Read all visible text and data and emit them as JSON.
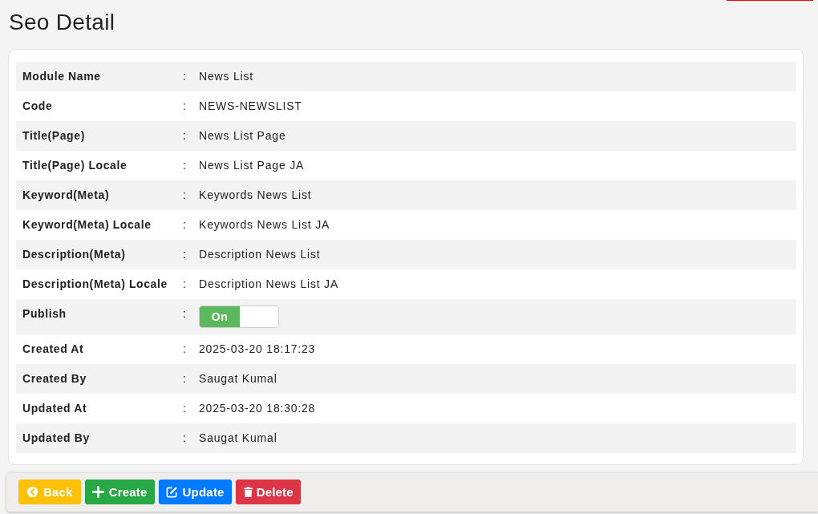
{
  "page": {
    "title": "Seo Detail"
  },
  "details": [
    {
      "kind": "text",
      "label": "Module Name",
      "separator": ":",
      "value": "News List"
    },
    {
      "kind": "text",
      "label": "Code",
      "separator": ":",
      "value": "NEWS-NEWSLIST"
    },
    {
      "kind": "text",
      "label": "Title(Page)",
      "separator": ":",
      "value": "News List Page"
    },
    {
      "kind": "text",
      "label": "Title(Page) Locale",
      "separator": ":",
      "value": "News List Page JA"
    },
    {
      "kind": "text",
      "label": "Keyword(Meta)",
      "separator": ":",
      "value": "Keywords News List"
    },
    {
      "kind": "text",
      "label": "Keyword(Meta) Locale",
      "separator": ":",
      "value": "Keywords News List JA"
    },
    {
      "kind": "text",
      "label": "Description(Meta)",
      "separator": ":",
      "value": "Description News List"
    },
    {
      "kind": "text",
      "label": "Description(Meta) Locale",
      "separator": ":",
      "value": "Description News List JA"
    },
    {
      "kind": "toggle",
      "label": "Publish",
      "separator": ":",
      "toggle": {
        "on": true,
        "text": "On"
      }
    },
    {
      "kind": "text",
      "label": "Created At",
      "separator": ":",
      "value": "2025-03-20 18:17:23"
    },
    {
      "kind": "text",
      "label": "Created By",
      "separator": ":",
      "value": "Saugat Kumal"
    },
    {
      "kind": "text",
      "label": "Updated At",
      "separator": ":",
      "value": "2025-03-20 18:30:28"
    },
    {
      "kind": "text",
      "label": "Updated By",
      "separator": ":",
      "value": "Saugat Kumal"
    }
  ],
  "actions": [
    {
      "kind": "back",
      "label": "Back"
    },
    {
      "kind": "create",
      "label": "Create"
    },
    {
      "kind": "update",
      "label": "Update"
    },
    {
      "kind": "delete",
      "label": "Delete"
    }
  ]
}
